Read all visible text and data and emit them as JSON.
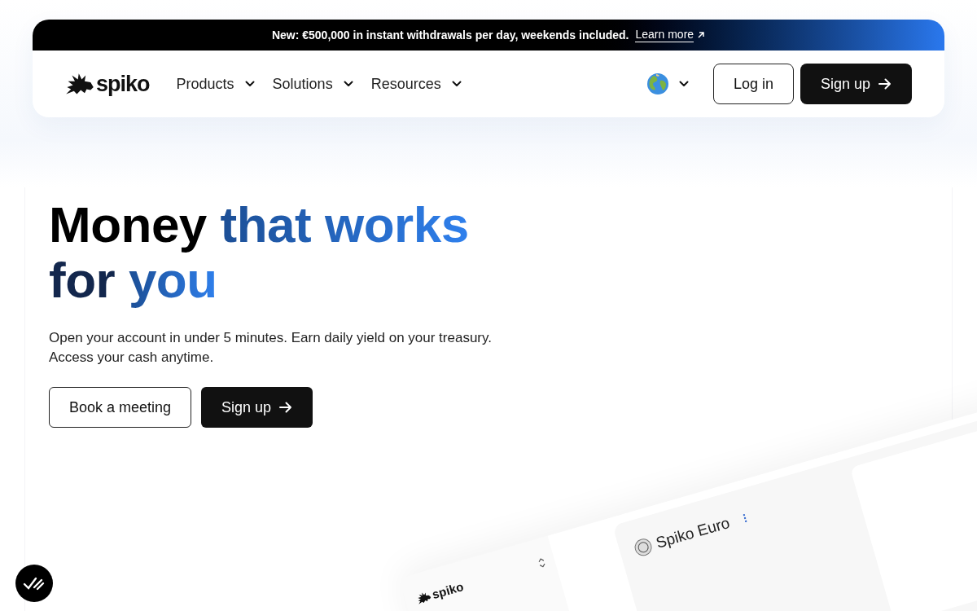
{
  "banner": {
    "text": "New: €500,000 in instant withdrawals per day, weekends included.",
    "link": "Learn more"
  },
  "nav": {
    "logo": "spiko",
    "items": [
      {
        "label": "Products",
        "expanded": false
      },
      {
        "label": "Solutions",
        "expanded": false
      },
      {
        "label": "Resources",
        "expanded": false
      }
    ],
    "login": "Log in",
    "signup": "Sign up"
  },
  "hero": {
    "heading": [
      [
        {
          "text": "Money",
          "accent": false
        },
        {
          "text": "that works",
          "accent": true
        }
      ],
      [
        {
          "text": "for",
          "accent": false
        },
        {
          "text": "you",
          "accent": true
        }
      ]
    ],
    "subtitle": "Open your account in under 5 minutes. Earn daily yield on your treasury. Access your cash anytime.",
    "buttons": [
      {
        "label": "Book a meeting",
        "kind": "outline"
      },
      {
        "label": "Sign up",
        "kind": "primary"
      }
    ]
  },
  "preview": {
    "logo": "spiko",
    "fund": "Spiko Euro"
  }
}
